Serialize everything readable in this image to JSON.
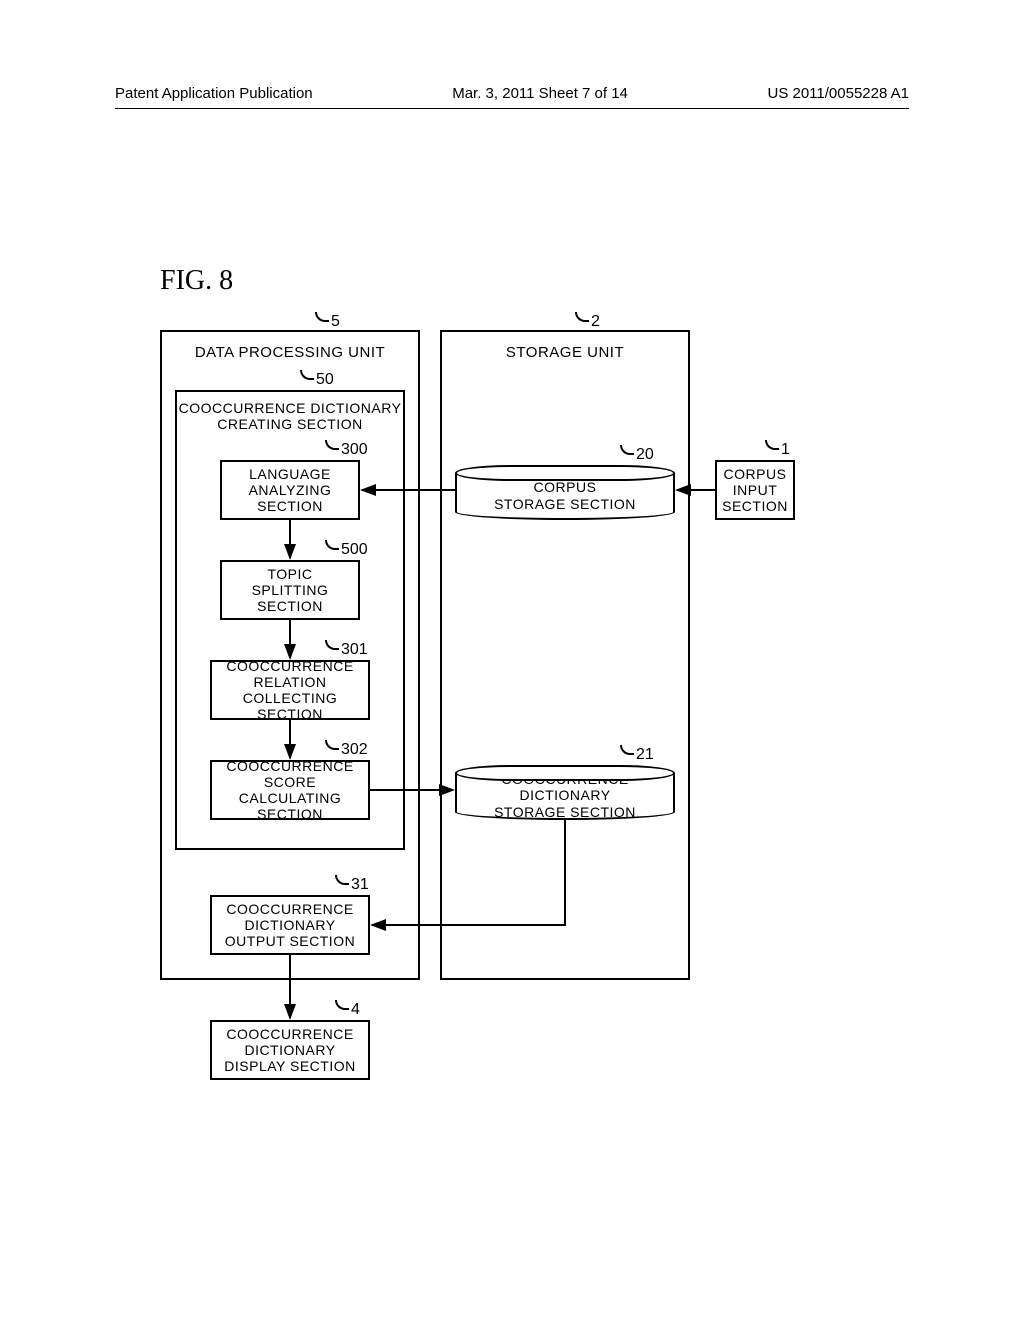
{
  "header": {
    "left": "Patent Application Publication",
    "center": "Mar. 3, 2011  Sheet 7 of 14",
    "right": "US 2011/0055228 A1"
  },
  "figure_label": "FIG. 8",
  "refs": {
    "r5": "5",
    "r2": "2",
    "r1": "1",
    "r50": "50",
    "r300": "300",
    "r500": "500",
    "r301": "301",
    "r302": "302",
    "r31": "31",
    "r4": "4",
    "r20": "20",
    "r21": "21"
  },
  "labels": {
    "data_processing_unit": "DATA PROCESSING UNIT",
    "storage_unit": "STORAGE UNIT",
    "cooccurrence_dictionary_creating_section_l1": "COOCCURRENCE DICTIONARY",
    "cooccurrence_dictionary_creating_section_l2": "CREATING SECTION",
    "language_analyzing_section_l1": "LANGUAGE",
    "language_analyzing_section_l2": "ANALYZING",
    "language_analyzing_section_l3": "SECTION",
    "topic_splitting_section_l1": "TOPIC",
    "topic_splitting_section_l2": "SPLITTING",
    "topic_splitting_section_l3": "SECTION",
    "cooccurrence_relation_collecting_l1": "COOCCURRENCE",
    "cooccurrence_relation_collecting_l2": "RELATION",
    "cooccurrence_relation_collecting_l3": "COLLECTING SECTION",
    "cooccurrence_score_calc_l1": "COOCCURRENCE",
    "cooccurrence_score_calc_l2": "SCORE CALCULATING",
    "cooccurrence_score_calc_l3": "SECTION",
    "cooccurrence_dict_output_l1": "COOCCURRENCE",
    "cooccurrence_dict_output_l2": "DICTIONARY",
    "cooccurrence_dict_output_l3": "OUTPUT SECTION",
    "cooccurrence_dict_display_l1": "COOCCURRENCE",
    "cooccurrence_dict_display_l2": "DICTIONARY",
    "cooccurrence_dict_display_l3": "DISPLAY SECTION",
    "corpus_storage_l1": "CORPUS",
    "corpus_storage_l2": "STORAGE SECTION",
    "cooccurrence_dict_storage_l1": "COOCCURRENCE DICTIONARY",
    "cooccurrence_dict_storage_l2": "STORAGE SECTION",
    "corpus_input_l1": "CORPUS",
    "corpus_input_l2": "INPUT",
    "corpus_input_l3": "SECTION"
  },
  "chart_data": {
    "type": "diagram",
    "title": "FIG. 8",
    "nodes": [
      {
        "id": "5",
        "label": "DATA PROCESSING UNIT",
        "kind": "container"
      },
      {
        "id": "2",
        "label": "STORAGE UNIT",
        "kind": "container"
      },
      {
        "id": "50",
        "label": "COOCCURRENCE DICTIONARY CREATING SECTION",
        "kind": "container",
        "parent": "5"
      },
      {
        "id": "300",
        "label": "LANGUAGE ANALYZING SECTION",
        "kind": "process",
        "parent": "50"
      },
      {
        "id": "500",
        "label": "TOPIC SPLITTING SECTION",
        "kind": "process",
        "parent": "50"
      },
      {
        "id": "301",
        "label": "COOCCURRENCE RELATION COLLECTING SECTION",
        "kind": "process",
        "parent": "50"
      },
      {
        "id": "302",
        "label": "COOCCURRENCE SCORE CALCULATING SECTION",
        "kind": "process",
        "parent": "50"
      },
      {
        "id": "31",
        "label": "COOCCURRENCE DICTIONARY OUTPUT SECTION",
        "kind": "process",
        "parent": "5"
      },
      {
        "id": "4",
        "label": "COOCCURRENCE DICTIONARY DISPLAY SECTION",
        "kind": "process"
      },
      {
        "id": "20",
        "label": "CORPUS STORAGE SECTION",
        "kind": "storage",
        "parent": "2"
      },
      {
        "id": "21",
        "label": "COOCCURRENCE DICTIONARY STORAGE SECTION",
        "kind": "storage",
        "parent": "2"
      },
      {
        "id": "1",
        "label": "CORPUS INPUT SECTION",
        "kind": "process"
      }
    ],
    "edges": [
      {
        "from": "1",
        "to": "20"
      },
      {
        "from": "20",
        "to": "300"
      },
      {
        "from": "300",
        "to": "500"
      },
      {
        "from": "500",
        "to": "301"
      },
      {
        "from": "301",
        "to": "302"
      },
      {
        "from": "302",
        "to": "21"
      },
      {
        "from": "21",
        "to": "31"
      },
      {
        "from": "31",
        "to": "4"
      }
    ]
  }
}
